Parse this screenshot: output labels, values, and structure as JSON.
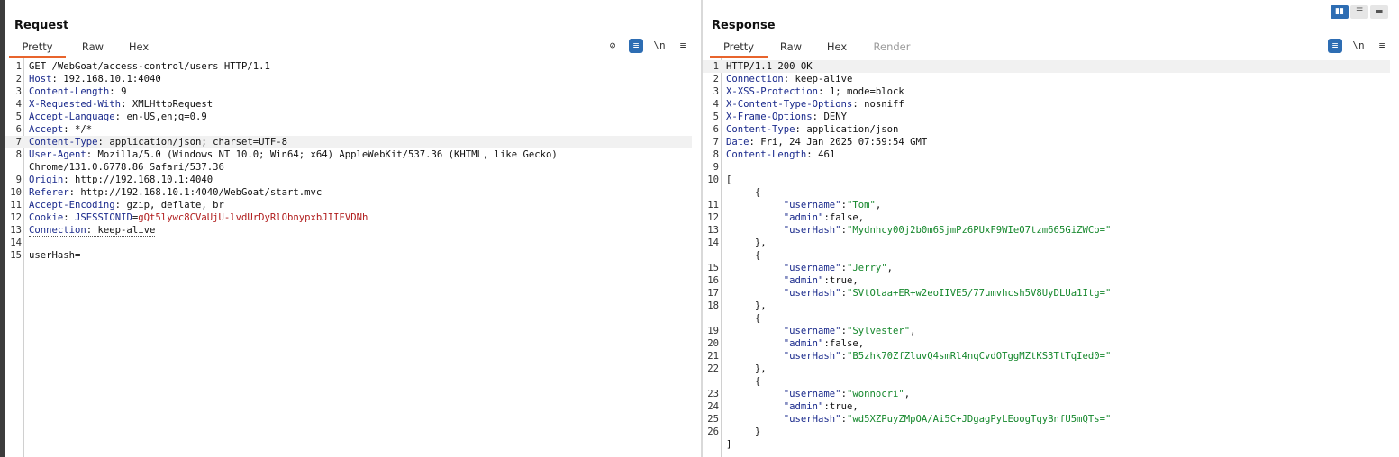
{
  "layout_buttons": [
    "▮▮",
    "☰",
    "▬"
  ],
  "request": {
    "title": "Request",
    "tabs": [
      "Pretty",
      "Raw",
      "Hex"
    ],
    "tools": {
      "eye": "⊘",
      "wrap": "≡",
      "newline": "\\n",
      "menu": "≡"
    },
    "lines": [
      {
        "n": "1",
        "key": "",
        "val": "GET /WebGoat/access-control/users HTTP/1.1"
      },
      {
        "n": "2",
        "key": "Host",
        "val": "192.168.10.1:4040"
      },
      {
        "n": "3",
        "key": "Content-Length",
        "val": "9"
      },
      {
        "n": "4",
        "key": "X-Requested-With",
        "val": "XMLHttpRequest"
      },
      {
        "n": "5",
        "key": "Accept-Language",
        "val": "en-US,en;q=0.9"
      },
      {
        "n": "6",
        "key": "Accept",
        "val": "*/*"
      },
      {
        "n": "7",
        "key": "Content-Type",
        "val": "application/json; charset=UTF-8",
        "hl": true
      },
      {
        "n": "8",
        "key": "User-Agent",
        "val": "Mozilla/5.0 (Windows NT 10.0; Win64; x64) AppleWebKit/537.36 (KHTML, like Gecko)"
      },
      {
        "n": "",
        "key": "",
        "val": "Chrome/131.0.6778.86 Safari/537.36"
      },
      {
        "n": "9",
        "key": "Origin",
        "val": "http://192.168.10.1:4040"
      },
      {
        "n": "10",
        "key": "Referer",
        "val": "http://192.168.10.1:4040/WebGoat/start.mvc"
      },
      {
        "n": "11",
        "key": "Accept-Encoding",
        "val": "gzip, deflate, br"
      },
      {
        "n": "12",
        "key": "Cookie",
        "val": "",
        "cookie_name": "JSESSIONID",
        "cookie_value": "gQt5lywc8CVaUjU-lvdUrDyRlObnypxbJIIEVDNh"
      },
      {
        "n": "13",
        "key": "Connection",
        "val": "keep-alive",
        "dotted": true
      },
      {
        "n": "14",
        "key": "",
        "val": ""
      },
      {
        "n": "15",
        "key": "",
        "val": "userHash="
      }
    ]
  },
  "response": {
    "title": "Response",
    "tabs": [
      "Pretty",
      "Raw",
      "Hex",
      "Render"
    ],
    "tools": {
      "wrap": "≡",
      "newline": "\\n",
      "menu": "≡"
    },
    "lines": [
      {
        "n": "1",
        "kind": "plain",
        "text": "HTTP/1.1 200 OK",
        "hl": true
      },
      {
        "n": "2",
        "kind": "hdr",
        "key": "Connection",
        "val": "keep-alive"
      },
      {
        "n": "3",
        "kind": "hdr",
        "key": "X-XSS-Protection",
        "val": "1; mode=block"
      },
      {
        "n": "4",
        "kind": "hdr",
        "key": "X-Content-Type-Options",
        "val": "nosniff"
      },
      {
        "n": "5",
        "kind": "hdr",
        "key": "X-Frame-Options",
        "val": "DENY"
      },
      {
        "n": "6",
        "kind": "hdr",
        "key": "Content-Type",
        "val": "application/json"
      },
      {
        "n": "7",
        "kind": "hdr",
        "key": "Date",
        "val": "Fri, 24 Jan 2025 07:59:54 GMT"
      },
      {
        "n": "8",
        "kind": "hdr",
        "key": "Content-Length",
        "val": "461"
      },
      {
        "n": "9",
        "kind": "plain",
        "text": ""
      },
      {
        "n": "10",
        "kind": "plain",
        "text": "["
      },
      {
        "n": "",
        "kind": "plain",
        "text": "     {"
      },
      {
        "n": "11",
        "kind": "json",
        "indent": "          ",
        "key": "\"username\"",
        "val": "\"Tom\"",
        "tail": ",",
        "isstr": true
      },
      {
        "n": "12",
        "kind": "json",
        "indent": "          ",
        "key": "\"admin\"",
        "val": "false",
        "tail": ",",
        "isstr": false
      },
      {
        "n": "13",
        "kind": "json",
        "indent": "          ",
        "key": "\"userHash\"",
        "val": "\"Mydnhcy00j2b0m6SjmPz6PUxF9WIeO7tzm665GiZWCo=\"",
        "tail": "",
        "isstr": true
      },
      {
        "n": "14",
        "kind": "plain",
        "text": "     },"
      },
      {
        "n": "",
        "kind": "plain",
        "text": "     {"
      },
      {
        "n": "15",
        "kind": "json",
        "indent": "          ",
        "key": "\"username\"",
        "val": "\"Jerry\"",
        "tail": ",",
        "isstr": true
      },
      {
        "n": "16",
        "kind": "json",
        "indent": "          ",
        "key": "\"admin\"",
        "val": "true",
        "tail": ",",
        "isstr": false
      },
      {
        "n": "17",
        "kind": "json",
        "indent": "          ",
        "key": "\"userHash\"",
        "val": "\"SVtOlaa+ER+w2eoIIVE5/77umvhcsh5V8UyDLUa1Itg=\"",
        "tail": "",
        "isstr": true
      },
      {
        "n": "18",
        "kind": "plain",
        "text": "     },"
      },
      {
        "n": "",
        "kind": "plain",
        "text": "     {"
      },
      {
        "n": "19",
        "kind": "json",
        "indent": "          ",
        "key": "\"username\"",
        "val": "\"Sylvester\"",
        "tail": ",",
        "isstr": true
      },
      {
        "n": "20",
        "kind": "json",
        "indent": "          ",
        "key": "\"admin\"",
        "val": "false",
        "tail": ",",
        "isstr": false
      },
      {
        "n": "21",
        "kind": "json",
        "indent": "          ",
        "key": "\"userHash\"",
        "val": "\"B5zhk70ZfZluvQ4smRl4nqCvdOTggMZtKS3TtTqIed0=\"",
        "tail": "",
        "isstr": true
      },
      {
        "n": "22",
        "kind": "plain",
        "text": "     },"
      },
      {
        "n": "",
        "kind": "plain",
        "text": "     {"
      },
      {
        "n": "23",
        "kind": "json",
        "indent": "          ",
        "key": "\"username\"",
        "val": "\"wonnocri\"",
        "tail": ",",
        "isstr": true
      },
      {
        "n": "24",
        "kind": "json",
        "indent": "          ",
        "key": "\"admin\"",
        "val": "true",
        "tail": ",",
        "isstr": false
      },
      {
        "n": "25",
        "kind": "json",
        "indent": "          ",
        "key": "\"userHash\"",
        "val": "\"wd5XZPuyZMpOA/Ai5C+JDgagPyLEoogTqyBnfU5mQTs=\"",
        "tail": "",
        "isstr": true
      },
      {
        "n": "26",
        "kind": "plain",
        "text": "     }"
      },
      {
        "n": "",
        "kind": "plain",
        "text": "]"
      }
    ]
  }
}
